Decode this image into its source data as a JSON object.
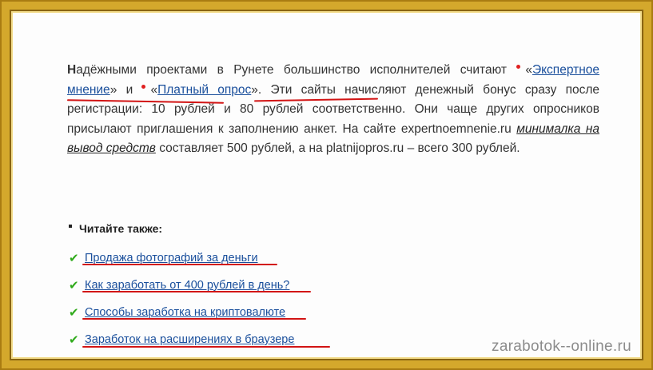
{
  "paragraph": {
    "lead_letter": "Н",
    "part1": "адёжными проектами в Рунете большинство исполнителей считают",
    "quote_open": "«",
    "link1": "Экспертное мнение",
    "quote_close": "»",
    "and": " и ",
    "link2": "Платный опрос",
    "part2": ". Эти сайты начисляют денежный бонус сразу после регистрации: 10 рублей и 80 рублей соответственно. Они чаще других опросников присылают приглашения к заполнению анкет. На сайте expertnoemnenie.ru",
    "italic_link": "минималка на вывод средств",
    "part3": " составляет 500 рублей, а на platnijopros.ru – всего 300 рублей."
  },
  "read_also": {
    "heading": "Читайте также:",
    "items": [
      "Продажа фотографий за деньги",
      "Как заработать от 400 рублей в день?",
      "Способы заработка на криптовалюте",
      "Заработок на расширениях в браузере"
    ]
  },
  "watermark": "zarabotok--online.ru",
  "colors": {
    "frame": "#d4a82c",
    "underline_mark": "#d21414",
    "check": "#2faa1b",
    "link": "#1a4f9c"
  }
}
